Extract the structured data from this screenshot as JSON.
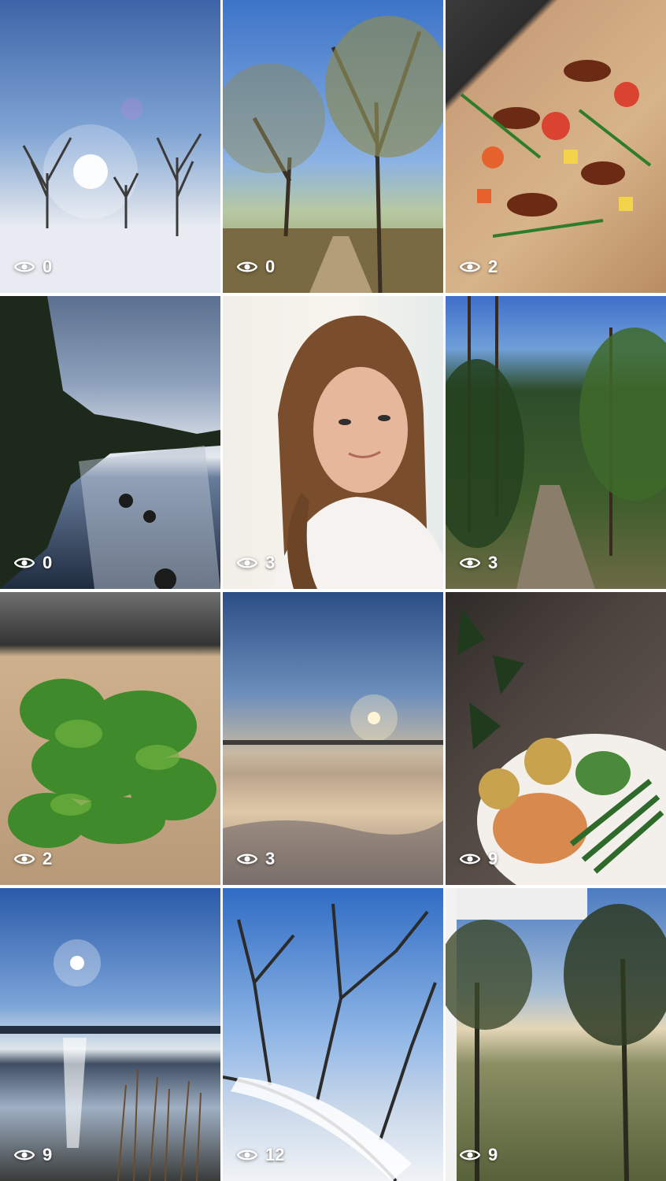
{
  "grid": {
    "tiles": [
      {
        "views": "0",
        "icon": "eye-icon"
      },
      {
        "views": "0",
        "icon": "eye-icon"
      },
      {
        "views": "2",
        "icon": "eye-icon"
      },
      {
        "views": "0",
        "icon": "eye-icon"
      },
      {
        "views": "3",
        "icon": "eye-icon"
      },
      {
        "views": "3",
        "icon": "eye-icon"
      },
      {
        "views": "2",
        "icon": "eye-icon"
      },
      {
        "views": "3",
        "icon": "eye-icon"
      },
      {
        "views": "9",
        "icon": "eye-icon"
      },
      {
        "views": "9",
        "icon": "eye-icon"
      },
      {
        "views": "12",
        "icon": "eye-icon"
      },
      {
        "views": "9",
        "icon": "eye-icon"
      }
    ]
  },
  "colors": {
    "background": "#ffffff",
    "overlay_text": "#ffffff"
  }
}
